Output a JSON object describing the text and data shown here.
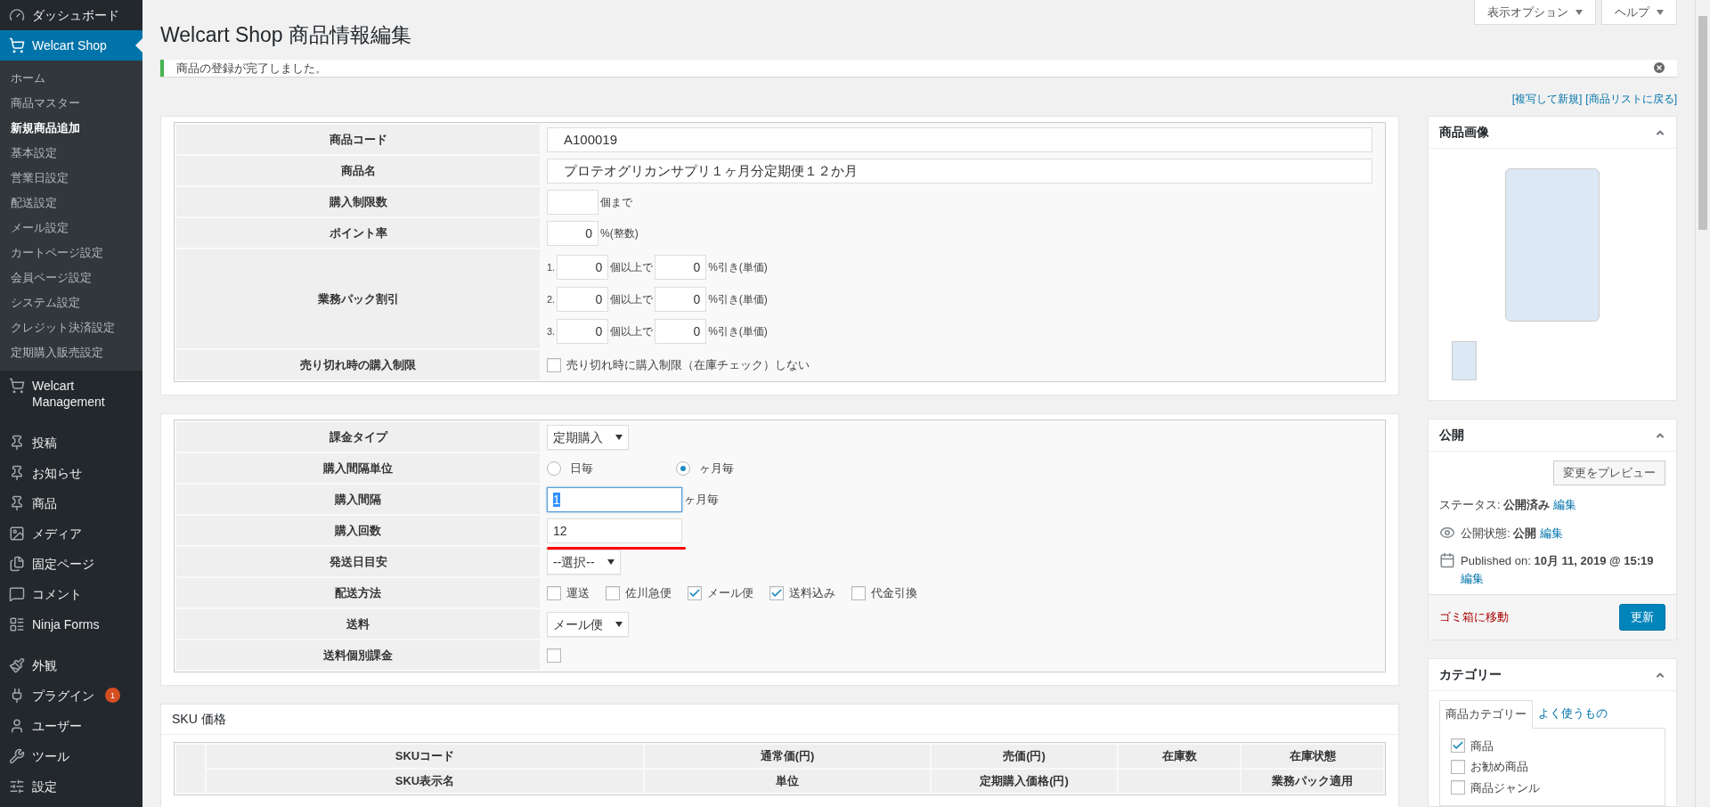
{
  "sidebar": {
    "items": [
      {
        "label": "ダッシュボード",
        "selected": false
      },
      {
        "label": "Welcart Shop",
        "selected": true,
        "children": [
          {
            "label": "ホーム",
            "selected": false
          },
          {
            "label": "商品マスター",
            "selected": false
          },
          {
            "label": "新規商品追加",
            "selected": true
          },
          {
            "label": "基本設定",
            "selected": false
          },
          {
            "label": "営業日設定",
            "selected": false
          },
          {
            "label": "配送設定",
            "selected": false
          },
          {
            "label": "メール設定",
            "selected": false
          },
          {
            "label": "カートページ設定",
            "selected": false
          },
          {
            "label": "会員ページ設定",
            "selected": false
          },
          {
            "label": "システム設定",
            "selected": false
          },
          {
            "label": "クレジット決済設定",
            "selected": false
          },
          {
            "label": "定期購入販売設定",
            "selected": false
          }
        ]
      },
      {
        "label": "Welcart Management",
        "selected": false
      },
      {
        "label": "投稿",
        "selected": false,
        "separator_before": true
      },
      {
        "label": "お知らせ",
        "selected": false
      },
      {
        "label": "商品",
        "selected": false
      },
      {
        "label": "メディア",
        "selected": false
      },
      {
        "label": "固定ページ",
        "selected": false
      },
      {
        "label": "コメント",
        "selected": false
      },
      {
        "label": "Ninja Forms",
        "selected": false
      },
      {
        "label": "外観",
        "selected": false,
        "separator_before": true
      },
      {
        "label": "プラグイン",
        "selected": false,
        "badge": "1"
      },
      {
        "label": "ユーザー",
        "selected": false
      },
      {
        "label": "ツール",
        "selected": false
      },
      {
        "label": "設定",
        "selected": false
      }
    ]
  },
  "screen_buttons": [
    "表示オプション",
    "ヘルプ"
  ],
  "title": "Welcart Shop 商品情報編集",
  "notice": "商品の登録が完了しました。",
  "links": [
    "[複写して新規]",
    "[商品リストに戻る]"
  ],
  "item_table": [
    {
      "label": "商品コード",
      "kind": "text",
      "value": "A100019"
    },
    {
      "label": "商品名",
      "kind": "text",
      "value": "プロテオグリカンサプリ１ヶ月分定期便１２か月"
    },
    {
      "label": "購入制限数",
      "kind": "number",
      "suffix": "個まで"
    },
    {
      "label": "ポイント率",
      "kind": "number",
      "value": "0",
      "suffix": "%(整数)"
    },
    {
      "label": "業務パック割引",
      "kind": "tiers",
      "tiers": [
        {
          "index": "1.",
          "qty": "0",
          "qty_suffix": "個以上で",
          "rate": "0",
          "rate_suffix": "%引き(単価)"
        },
        {
          "index": "2.",
          "qty": "0",
          "qty_suffix": "個以上で",
          "rate": "0",
          "rate_suffix": "%引き(単価)"
        },
        {
          "index": "3.",
          "qty": "0",
          "qty_suffix": "個以上で",
          "rate": "0",
          "rate_suffix": "%引き(単価)"
        }
      ]
    },
    {
      "label": "売り切れ時の購入制限",
      "kind": "checkboxes",
      "options": [
        {
          "label": "売り切れ時に購入制限（在庫チェック）しない",
          "checked": false
        }
      ]
    }
  ],
  "subscription_table": [
    {
      "label": "課金タイプ",
      "kind": "select",
      "value": "定期購入"
    },
    {
      "label": "購入間隔単位",
      "kind": "radios",
      "options": [
        {
          "label": "日毎",
          "selected": false
        },
        {
          "label": "ヶ月毎",
          "selected": true
        }
      ]
    },
    {
      "label": "購入間隔",
      "kind": "field",
      "value": "1",
      "focused": true,
      "suffix": "ヶ月毎"
    },
    {
      "label": "購入回数",
      "kind": "field",
      "value": "12",
      "focused": false,
      "underlined": true
    },
    {
      "label": "発送日目安",
      "kind": "select",
      "value": "--選択--"
    },
    {
      "label": "配送方法",
      "kind": "checkboxes",
      "options": [
        {
          "label": "運送",
          "checked": false
        },
        {
          "label": "佐川急便",
          "checked": false
        },
        {
          "label": "メール便",
          "checked": true
        },
        {
          "label": "送料込み",
          "checked": true
        },
        {
          "label": "代金引換",
          "checked": false
        }
      ]
    },
    {
      "label": "送料",
      "kind": "select",
      "value": "メール便"
    },
    {
      "label": "送料個別課金",
      "kind": "checkboxes",
      "options": [
        {
          "checked": false
        }
      ]
    }
  ],
  "sku": {
    "title": "SKU 価格",
    "columns": [
      {
        "top": "SKUコード",
        "bottom": "SKU表示名"
      },
      {
        "top": "通常価(円)",
        "bottom": "単位"
      },
      {
        "top": "売価(円)",
        "bottom": "定期購入価格(円)"
      },
      {
        "top": "在庫数"
      },
      {
        "top": "在庫状態",
        "bottom": "業務パック適用"
      }
    ]
  },
  "image_box": {
    "title": "商品画像"
  },
  "publish": {
    "title": "公開",
    "preview_button": "変更をプレビュー",
    "status": {
      "label": "ステータス:",
      "value": "公開済み",
      "link": "編集"
    },
    "visibility": {
      "label": "公開状態:",
      "value": "公開",
      "link": "編集"
    },
    "published": {
      "label": "Published on:",
      "value": "10月 11, 2019 @ 15:19",
      "link": "編集"
    },
    "trash": "ゴミ箱に移動",
    "update": "更新"
  },
  "category": {
    "title": "カテゴリー",
    "tabs": [
      {
        "label": "商品カテゴリー",
        "selected": true
      },
      {
        "label": "よく使うもの",
        "selected": false
      }
    ],
    "items": [
      {
        "label": "商品",
        "checked": true
      },
      {
        "label": "お勧め商品",
        "checked": false
      },
      {
        "label": "商品ジャンル",
        "checked": false
      }
    ]
  }
}
